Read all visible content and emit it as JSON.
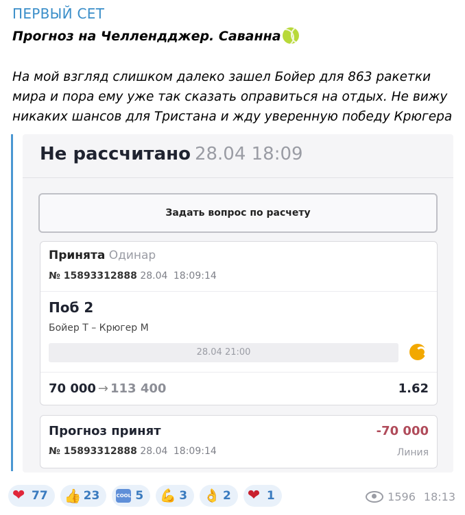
{
  "channel": {
    "name": "ПЕРВЫЙ СЕТ"
  },
  "post": {
    "title": "Прогноз на Челлендджер. Саванна",
    "title_icon": "tennis-ball-icon",
    "body": "На мой взгляд слишком далеко зашел Бойер для 863 ракетки мира и пора ему уже так сказать оправиться на отдых. Не вижу никаких шансов для Тристана и жду уверенную победу Крюгера"
  },
  "bet_card": {
    "status": "Не рассчитано",
    "status_date": "28.04 18:09",
    "ask_button": "Задать вопрос по расчету",
    "bet": {
      "accepted": "Принята",
      "type": "Одинар",
      "number": "№ 15893312888",
      "date": "28.04",
      "time": "18:09:14",
      "outcome": "Поб 2",
      "teams": "Бойер Т – Крюгер М",
      "event_date": "28.04 21:00",
      "sport_icon": "tennis-icon",
      "stake": "70 000",
      "payout": "113 400",
      "odds": "1.62"
    },
    "forecast": {
      "title": "Прогноз принят",
      "amount": "-70 000",
      "number": "№ 15893312888",
      "date": "28.04",
      "time": "18:09:14",
      "line": "Линия"
    }
  },
  "reactions": [
    {
      "icon": "heart-icon",
      "glyph": "❤",
      "count": "77"
    },
    {
      "icon": "thumbs-up-icon",
      "glyph": "👍",
      "count": "23"
    },
    {
      "icon": "cool-icon",
      "glyph": "COOL",
      "count": "5"
    },
    {
      "icon": "flexed-biceps-icon",
      "glyph": "💪",
      "count": "3"
    },
    {
      "icon": "ok-hand-icon",
      "glyph": "👌",
      "count": "2"
    },
    {
      "icon": "heart-on-fire-icon",
      "glyph": "❤",
      "count": "1"
    }
  ],
  "meta": {
    "views": "1596",
    "time": "18:13"
  }
}
